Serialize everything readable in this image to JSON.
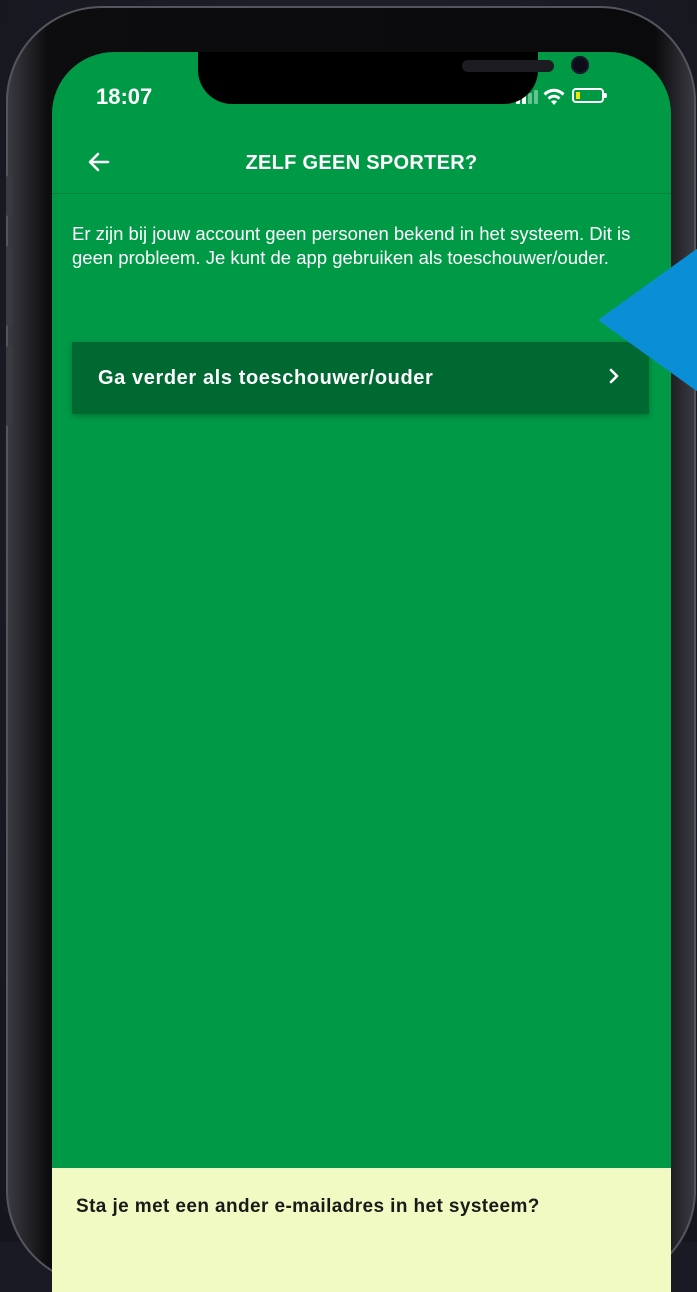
{
  "status_bar": {
    "time": "18:07"
  },
  "navbar": {
    "title": "ZELF GEEN SPORTER?",
    "back_icon": "arrow-left-icon"
  },
  "info_text": "Er zijn bij jouw account geen personen bekend in het systeem. Dit is geen probleem. Je kunt de app gebruiken als toeschouwer/ouder.",
  "actions": {
    "continue_label": "Ga verder als toeschouwer/ouder",
    "continue_icon": "chevron-right-icon"
  },
  "bottom_panel": {
    "text": "Sta je met een ander e-mailadres in het systeem?"
  },
  "colors": {
    "screen_background": "#009a47",
    "button_background": "#006831",
    "pointer_arrow": "#0a8fd6",
    "bottom_panel_background": "#f2fac3"
  }
}
